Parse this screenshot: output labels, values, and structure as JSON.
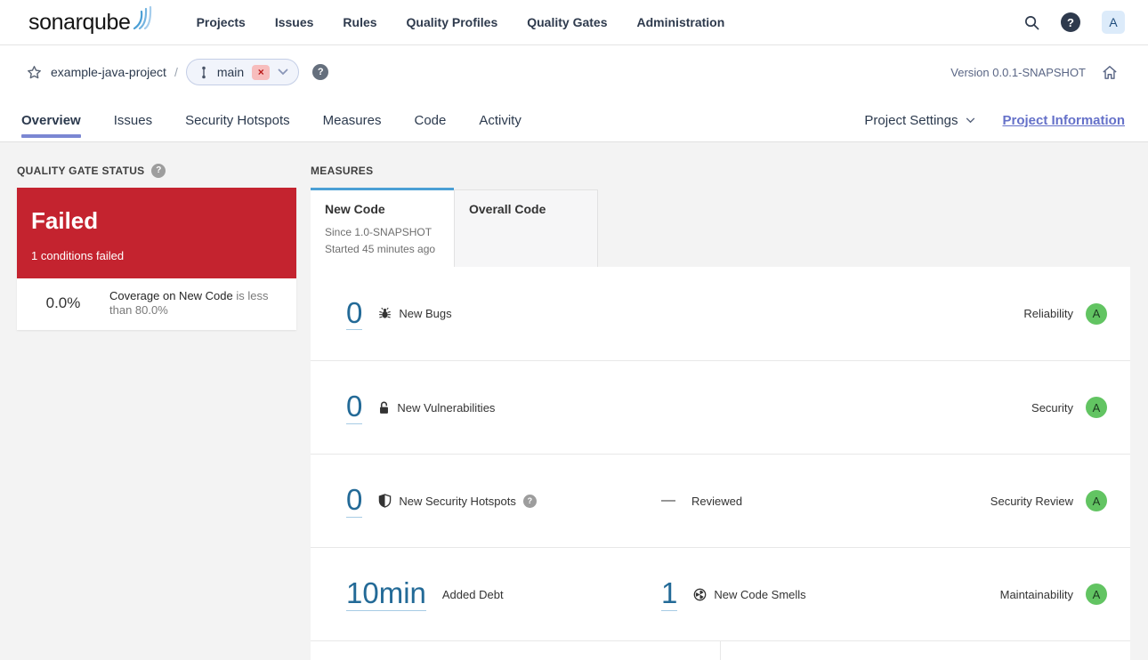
{
  "colors": {
    "accent_blue": "#4b9fd5",
    "link_blue": "#236a97",
    "failed_red": "#c4232f",
    "rating_a_green": "#62c462",
    "tab_underline_purple": "#7b87d3",
    "project_info_link": "#6571c9"
  },
  "topbar": {
    "logo_bold": "sonar",
    "logo_light": "qube",
    "nav": [
      "Projects",
      "Issues",
      "Rules",
      "Quality Profiles",
      "Quality Gates",
      "Administration"
    ],
    "help": "?",
    "avatar": "A"
  },
  "header": {
    "project": "example-java-project",
    "separator": "/",
    "branch": "main",
    "branch_close": "×",
    "branch_help": "?",
    "version": "Version 0.0.1-SNAPSHOT"
  },
  "tabs": [
    "Overview",
    "Issues",
    "Security Hotspots",
    "Measures",
    "Code",
    "Activity"
  ],
  "actions": {
    "project_settings": "Project Settings",
    "project_information": "Project Information"
  },
  "quality_gate": {
    "title": "QUALITY GATE STATUS",
    "help": "?",
    "status": "Failed",
    "conditions": "1 conditions failed",
    "condition_value": "0.0%",
    "condition_metric": "Coverage on New Code",
    "condition_rule": "is less than 80.0%"
  },
  "measures": {
    "title": "MEASURES",
    "tab_new_code": "New Code",
    "tab_new_code_line1": "Since 1.0-SNAPSHOT",
    "tab_new_code_line2": "Started 45 minutes ago",
    "tab_overall": "Overall Code",
    "rows": [
      {
        "value": "0",
        "label": "New Bugs",
        "domain": "Reliability",
        "rating": "A"
      },
      {
        "value": "0",
        "label": "New Vulnerabilities",
        "domain": "Security",
        "rating": "A"
      },
      {
        "value": "0",
        "label": "New Security Hotspots",
        "help": "?",
        "dash": "—",
        "mid_label": "Reviewed",
        "domain": "Security Review",
        "rating": "A"
      },
      {
        "value": "10min",
        "label": "Added Debt",
        "value2": "1",
        "label2": "New Code Smells",
        "domain": "Maintainability",
        "rating": "A"
      }
    ]
  },
  "icons": {
    "logo-waves-icon": "three blue arcs",
    "search-icon": "magnifier",
    "help-icon": "? in circle",
    "star-icon": "☆",
    "branch-icon": "git line with dots",
    "close-icon": "×",
    "chevron-down-icon": "⌄",
    "home-icon": "⌂",
    "bug-icon": "insect",
    "lock-open-icon": "open padlock",
    "shield-icon": "half-filled shield",
    "code-smell-icon": "circle with three wedges"
  }
}
